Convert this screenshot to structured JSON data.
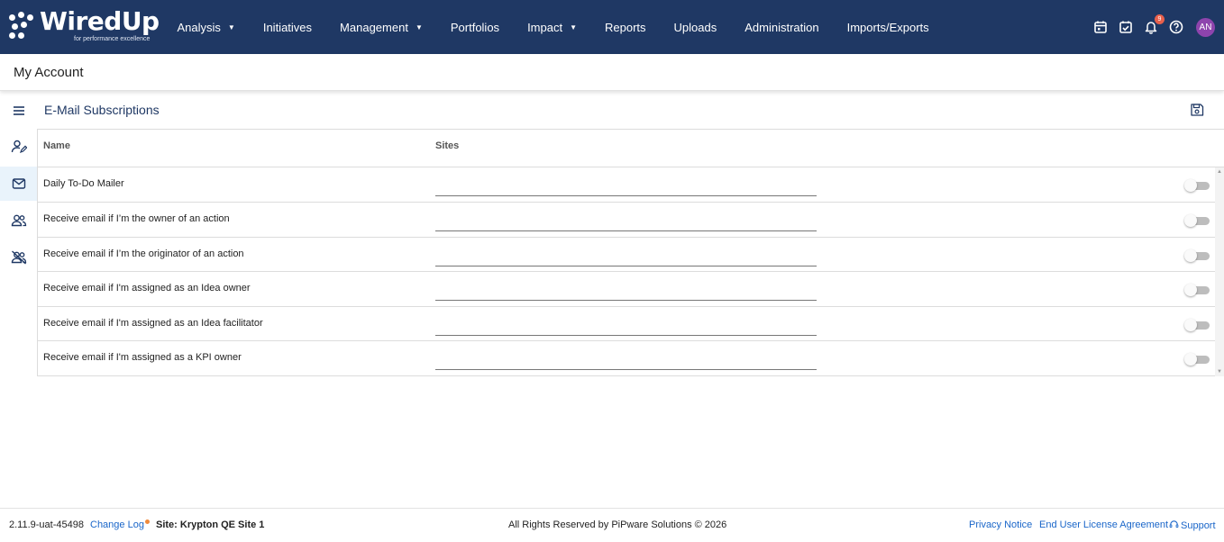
{
  "brand": {
    "name": "WiredUp",
    "tagline": "for performance excellence"
  },
  "nav": {
    "items": [
      {
        "label": "Analysis",
        "dropdown": true
      },
      {
        "label": "Initiatives",
        "dropdown": false
      },
      {
        "label": "Management",
        "dropdown": true
      },
      {
        "label": "Portfolios",
        "dropdown": false
      },
      {
        "label": "Impact",
        "dropdown": true
      },
      {
        "label": "Reports",
        "dropdown": false
      },
      {
        "label": "Uploads",
        "dropdown": false
      },
      {
        "label": "Administration",
        "dropdown": false
      },
      {
        "label": "Imports/Exports",
        "dropdown": false
      }
    ],
    "caret": "▼",
    "notification_count": "9",
    "avatar_initials": "AN"
  },
  "page": {
    "title": "My Account",
    "section_title": "E-Mail Subscriptions"
  },
  "table": {
    "columns": [
      "Name",
      "Sites"
    ],
    "rows": [
      {
        "name": "Daily To-Do Mailer",
        "enabled": false
      },
      {
        "name": "Receive email if I’m the owner of an action",
        "enabled": false
      },
      {
        "name": "Receive email if I’m the originator of an action",
        "enabled": false
      },
      {
        "name": "Receive email if I'm assigned as an Idea owner",
        "enabled": false
      },
      {
        "name": "Receive email if I'm assigned as an Idea facilitator",
        "enabled": false
      },
      {
        "name": "Receive email if I'm assigned as a KPI owner",
        "enabled": false
      }
    ]
  },
  "footer": {
    "version": "2.11.9-uat-45498",
    "change_log": "Change Log",
    "site": "Site: Krypton QE Site 1",
    "copyright": "All Rights Reserved by PiPware Solutions © 2026",
    "privacy": "Privacy Notice",
    "eula": "End User License Agreement",
    "support": "Support"
  },
  "colors": {
    "nav_bg": "#1f3864",
    "accent": "#1a66c9",
    "badge": "#e8604c",
    "avatar": "#8e44ad"
  }
}
